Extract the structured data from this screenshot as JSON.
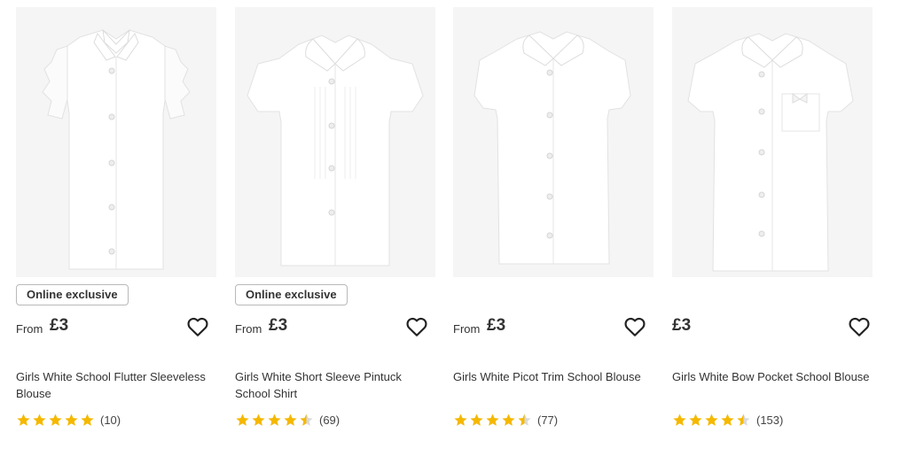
{
  "colors": {
    "star": "#f5b800",
    "star_empty": "#d9d9d9",
    "text": "#333333",
    "badge_border": "#b9b9b9"
  },
  "products": [
    {
      "badge": "Online exclusive",
      "price_prefix": "From",
      "price": "£3",
      "title": "Girls White School Flutter Sleeveless Blouse",
      "rating": 5,
      "reviews": "(10)",
      "image": "white-flutter-sleeveless-blouse",
      "wishlist_icon": "heart-outline-icon"
    },
    {
      "badge": "Online exclusive",
      "price_prefix": "From",
      "price": "£3",
      "title": "Girls White Short Sleeve Pintuck School Shirt",
      "rating": 4.5,
      "reviews": "(69)",
      "image": "white-pintuck-short-sleeve-shirt",
      "wishlist_icon": "heart-outline-icon"
    },
    {
      "badge": "",
      "price_prefix": "From",
      "price": "£3",
      "title": "Girls White Picot Trim School Blouse",
      "rating": 4.5,
      "reviews": "(77)",
      "image": "white-picot-trim-blouse",
      "wishlist_icon": "heart-outline-icon"
    },
    {
      "badge": "",
      "price_prefix": "",
      "price": "£3",
      "title": "Girls White Bow Pocket School Blouse",
      "rating": 4.5,
      "reviews": "(153)",
      "image": "white-bow-pocket-blouse",
      "wishlist_icon": "heart-outline-icon"
    }
  ]
}
